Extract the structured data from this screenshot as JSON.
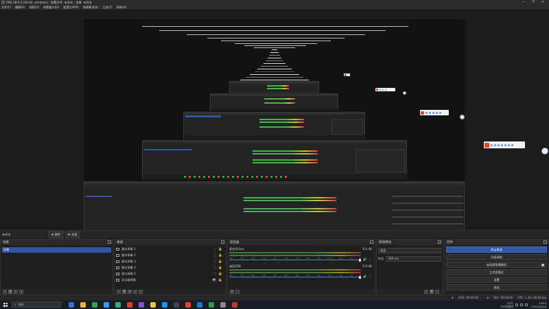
{
  "window": {
    "title": "OBS 28.0.3 (64-bit, windows) - 配置文件: 未命名 - 场景: 未命名",
    "controls": [
      "—",
      "❐",
      "✕"
    ]
  },
  "menu": [
    "文件(F)",
    "编辑(E)",
    "视图(V)",
    "停靠窗口(D)",
    "配置文件(P)",
    "场景集合(S)",
    "工具(T)",
    "帮助(H)"
  ],
  "toolbar": {
    "scene_label": "未命名",
    "properties_label": "属性",
    "filters_label": "滤镜"
  },
  "docks": {
    "scenes": {
      "title": "场景",
      "items": [
        "场景"
      ]
    },
    "sources": {
      "title": "来源",
      "items": [
        "窗口采集 1",
        "窗口采集 2",
        "窗口采集 3",
        "窗口采集 4",
        "窗口采集 5",
        "显示器采集"
      ]
    },
    "mixer": {
      "title": "混音器",
      "channels": [
        {
          "name": "麦克风/Aux",
          "db": "0.0 dB"
        },
        {
          "name": "桌面音频",
          "db": "0.0 dB"
        }
      ],
      "scale": [
        "-60",
        "-55",
        "-50",
        "-45",
        "-40",
        "-35",
        "-30",
        "-25",
        "-20",
        "-15",
        "-10",
        "-5",
        "0"
      ]
    },
    "transitions": {
      "title": "转场特效",
      "fade": "淡出",
      "duration_label": "时长",
      "duration": "300 ms"
    },
    "controls": {
      "title": "控件",
      "buttons": [
        "停止推流",
        "开始录制",
        "启动虚拟摄像机",
        "工作室模式",
        "设置",
        "退出"
      ]
    }
  },
  "status": {
    "live": "LIVE: 00:00:00",
    "rec": "REC: 00:00:00",
    "cpu": "CPU: 1.4%, 60.00 fps"
  },
  "taskbar": {
    "search_placeholder": "搜索",
    "weather_temp": "22℃",
    "weather_text": "CPU利用率",
    "time": "10:09",
    "date": "2022/10/28",
    "apps": [
      "#3a6fd8",
      "#f2b233",
      "#30a14e",
      "#3399ff",
      "#2fb07a",
      "#d24726",
      "#7a57c8",
      "#e8c542",
      "#1e90ff",
      "#444444",
      "#e5432b",
      "#0f7bd6",
      "#2aa04a",
      "#888888",
      "#c0392b"
    ]
  }
}
